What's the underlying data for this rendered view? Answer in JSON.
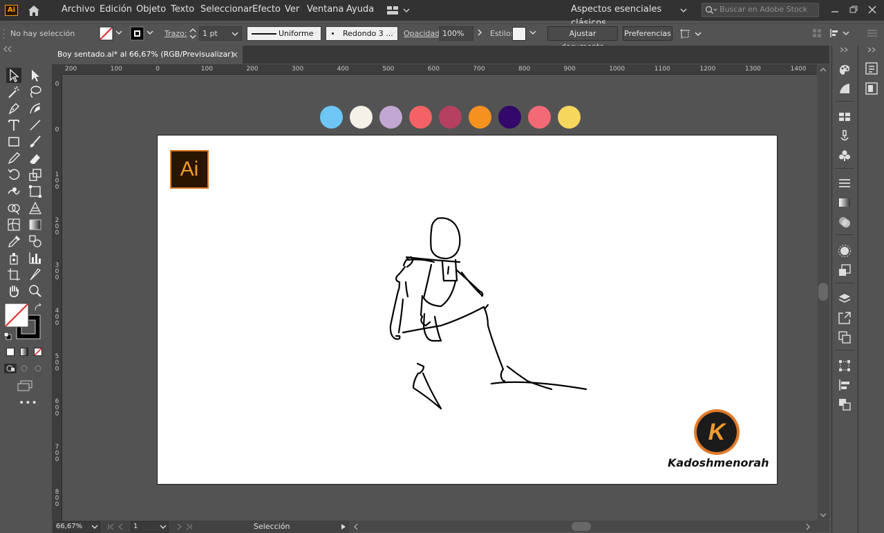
{
  "app": {
    "badge": "Ai",
    "menus": [
      "Archivo",
      "Edición",
      "Objeto",
      "Texto",
      "Seleccionar",
      "Efecto",
      "Ver",
      "Ventana",
      "Ayuda"
    ],
    "workspace": "Aspectos esenciales clásicos",
    "search_placeholder": "Buscar en Adobe Stock"
  },
  "control_bar": {
    "selection_status": "No hay selección",
    "stroke_label": "Trazo:",
    "stroke_weight": "1 pt",
    "stroke_profile": "Uniforme",
    "brush": "Redondo 3 ...",
    "opacity_label": "Opacidad:",
    "opacity_value": "100%",
    "style_label": "Estilo:",
    "fit_document_button": "Ajustar documento",
    "preferences_button": "Preferencias"
  },
  "document": {
    "tab_title": "Boy sentado.ai* al 66,67% (RGB/Previsualizar)",
    "close_glyph": "×"
  },
  "rulers": {
    "horizontal": [
      "200",
      "100",
      "0",
      "100",
      "200",
      "300",
      "400",
      "500",
      "600",
      "700",
      "800",
      "900",
      "1000",
      "1100",
      "1200",
      "1300",
      "1400"
    ],
    "vertical": [
      "0",
      "0",
      "1 0 0",
      "2 0 0",
      "3 0 0",
      "4 0 0",
      "5 0 0",
      "6 0 0",
      "7 0 0",
      "8 0 0"
    ]
  },
  "artwork": {
    "logo_text": "Ai",
    "brand_letter": "K",
    "brand_name": "Kadoshmenorah",
    "swatches": [
      "#6ec6f5",
      "#f5f1e8",
      "#c2a7d2",
      "#f36264",
      "#b5405f",
      "#f5921f",
      "#33086a",
      "#f26a75",
      "#f7d65e"
    ]
  },
  "status_bar": {
    "zoom": "66,67%",
    "artboard_number": "1",
    "tool_name": "Selección"
  },
  "colors": {
    "accent": "#ff9a00",
    "brand_orange": "#e07a2b"
  }
}
